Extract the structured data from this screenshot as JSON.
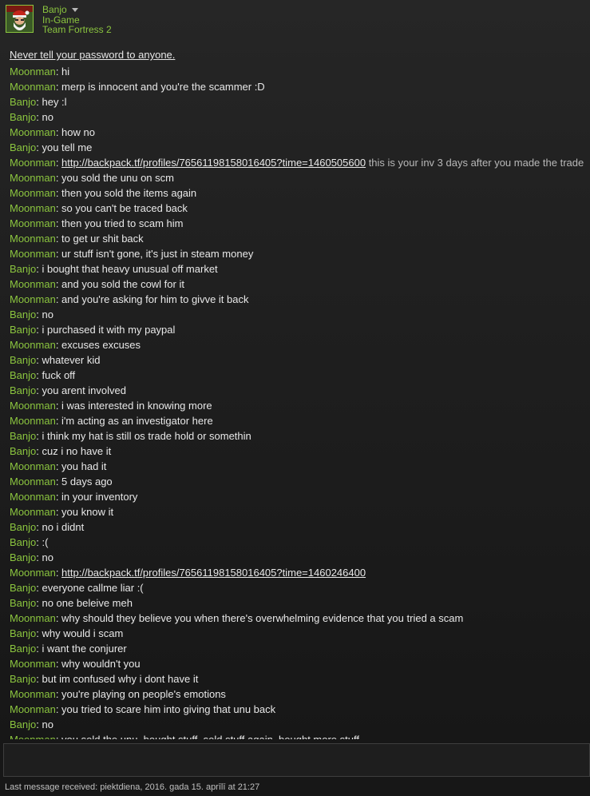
{
  "header": {
    "username": "Banjo",
    "status": "In-Game",
    "game": "Team Fortress 2"
  },
  "warning": "Never tell your password to anyone.",
  "messages": [
    {
      "sender": "Moonman",
      "text": "hi"
    },
    {
      "sender": "Moonman",
      "text": "merp is innocent and you're the scammer :D"
    },
    {
      "sender": "Banjo",
      "text": "hey :l"
    },
    {
      "sender": "Banjo",
      "text": "no"
    },
    {
      "sender": "Moonman",
      "text": "how no"
    },
    {
      "sender": "Banjo",
      "text": "you tell me"
    },
    {
      "sender": "Moonman",
      "text": "",
      "link": "http://backpack.tf/profiles/76561198158016405?time=1460505600",
      "suffix": " this is your inv 3 days after you made the trade"
    },
    {
      "sender": "Moonman",
      "text": "you sold the unu on scm"
    },
    {
      "sender": "Moonman",
      "text": "then you sold the items again"
    },
    {
      "sender": "Moonman",
      "text": "so you can't be traced back"
    },
    {
      "sender": "Moonman",
      "text": "then you tried to scam him"
    },
    {
      "sender": "Moonman",
      "text": "to get ur shit back"
    },
    {
      "sender": "Moonman",
      "text": "ur stuff isn't gone, it's just in steam money"
    },
    {
      "sender": "Banjo",
      "text": "i bought that heavy unusual off market"
    },
    {
      "sender": "Moonman",
      "text": "and you sold the cowl for it"
    },
    {
      "sender": "Moonman",
      "text": "and you're asking for him to givve it back"
    },
    {
      "sender": "Banjo",
      "text": "no"
    },
    {
      "sender": "Banjo",
      "text": "i purchased it with my paypal"
    },
    {
      "sender": "Moonman",
      "text": "excuses excuses"
    },
    {
      "sender": "Banjo",
      "text": "whatever kid"
    },
    {
      "sender": "Banjo",
      "text": "fuck off"
    },
    {
      "sender": "Banjo",
      "text": "you arent involved"
    },
    {
      "sender": "Moonman",
      "text": "i was interested in knowing more"
    },
    {
      "sender": "Moonman",
      "text": "i'm acting as an investigator here"
    },
    {
      "sender": "Banjo",
      "text": "i think my hat is still os trade hold or somethin"
    },
    {
      "sender": "Banjo",
      "text": "cuz i no have it"
    },
    {
      "sender": "Moonman",
      "text": "you had it"
    },
    {
      "sender": "Moonman",
      "text": "5 days ago"
    },
    {
      "sender": "Moonman",
      "text": "in your inventory"
    },
    {
      "sender": "Moonman",
      "text": "you know it"
    },
    {
      "sender": "Banjo",
      "text": "no i didnt"
    },
    {
      "sender": "Banjo",
      "text": ":("
    },
    {
      "sender": "Banjo",
      "text": "no"
    },
    {
      "sender": "Moonman",
      "text": "",
      "link": "http://backpack.tf/profiles/76561198158016405?time=1460246400",
      "suffix": ""
    },
    {
      "sender": "Banjo",
      "text": "everyone callme liar :("
    },
    {
      "sender": "Banjo",
      "text": "no one beleive meh"
    },
    {
      "sender": "Moonman",
      "text": "why should they believe you when there's overwhelming evidence that you tried a scam"
    },
    {
      "sender": "Banjo",
      "text": "why would i scam"
    },
    {
      "sender": "Banjo",
      "text": "i want the conjurer"
    },
    {
      "sender": "Moonman",
      "text": "why wouldn't you"
    },
    {
      "sender": "Banjo",
      "text": "but im confused why i dont have it"
    },
    {
      "sender": "Moonman",
      "text": "you're playing on people's emotions"
    },
    {
      "sender": "Moonman",
      "text": "you tried to scare him into giving that unu back"
    },
    {
      "sender": "Banjo",
      "text": "no"
    },
    {
      "sender": "Moonman",
      "text": "you sold the unu, bought stuff, sold stuff again, bought more stuff"
    }
  ],
  "input": {
    "value": ""
  },
  "footer": "Last message received: piektdiena, 2016. gada 15. aprīlī at 21:27",
  "colors": {
    "sender": "#8bc53f",
    "text": "#e8e8e8",
    "background": "#1c1c1c"
  }
}
